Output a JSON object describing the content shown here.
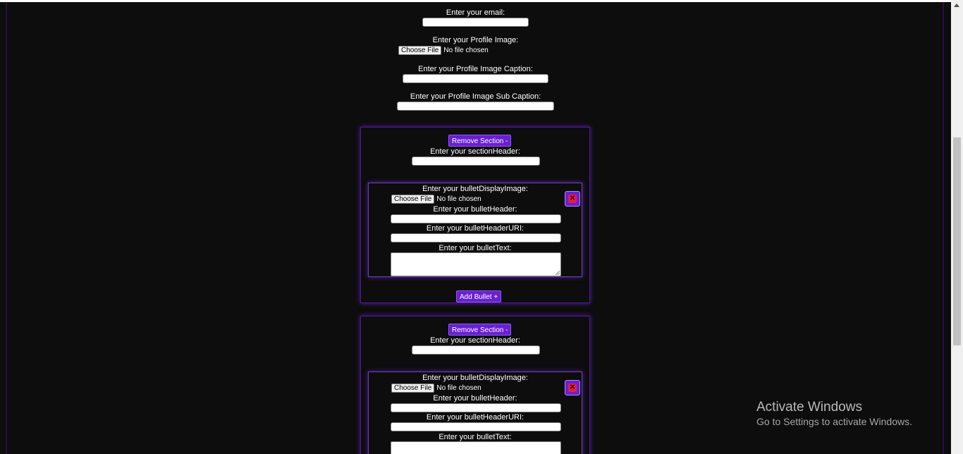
{
  "form": {
    "email_label": "Enter your email:",
    "profile_image_label": "Enter your Profile Image:",
    "profile_caption_label": "Enter your Profile Image Caption:",
    "profile_subcaption_label": "Enter your Profile Image Sub Caption:"
  },
  "file_input": {
    "choose_label": "Choose File",
    "no_file_text": "No file chosen"
  },
  "sections": [
    {
      "remove_label": "Remove Section -",
      "header_label": "Enter your sectionHeader:",
      "bullet": {
        "display_image_label": "Enter your bulletDisplayImage:",
        "header_label": "Enter your bulletHeader:",
        "uri_label": "Enter your bulletHeaderURI:",
        "text_label": "Enter your bulletText:",
        "delete_icon": "close-icon"
      },
      "add_bullet_label": "Add Bullet +"
    },
    {
      "remove_label": "Remove Section -",
      "header_label": "Enter your sectionHeader:",
      "bullet": {
        "display_image_label": "Enter your bulletDisplayImage:",
        "header_label": "Enter your bulletHeader:",
        "uri_label": "Enter your bulletHeaderURI:",
        "text_label": "Enter your bulletText:",
        "delete_icon": "close-icon"
      }
    }
  ],
  "watermark": {
    "title": "Activate Windows",
    "subtitle": "Go to Settings to activate Windows."
  },
  "colors": {
    "page_background": "#0d0d0d",
    "accent_purple": "#6a1fd1",
    "delete_red": "#e11d48"
  }
}
